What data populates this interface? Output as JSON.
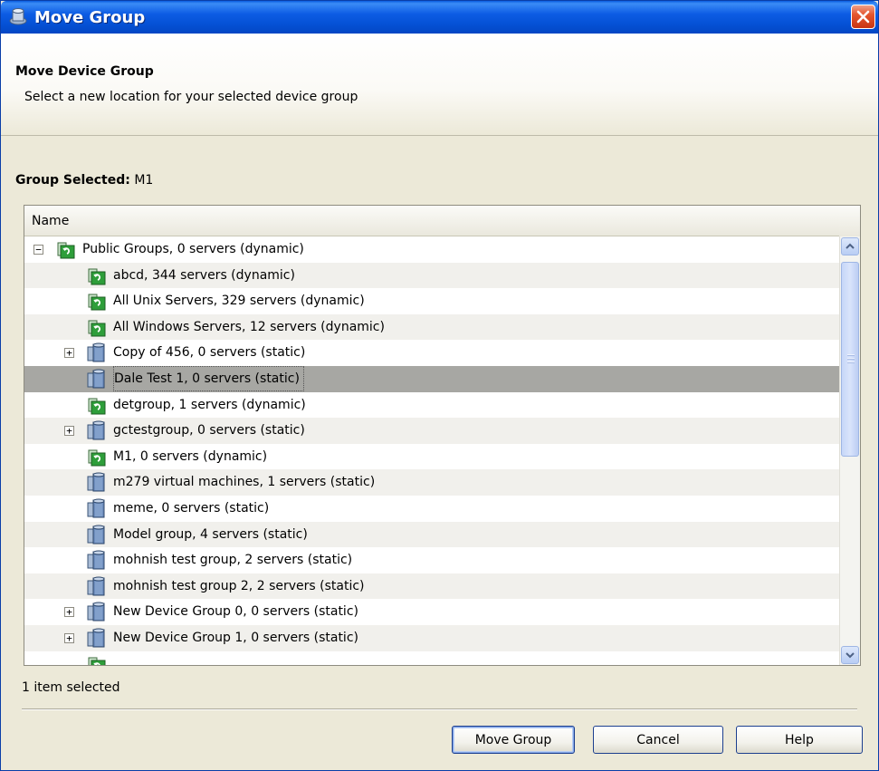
{
  "window": {
    "title": "Move Group"
  },
  "header": {
    "title": "Move Device Group",
    "subtitle": "Select a new location for your selected device group"
  },
  "group_selected": {
    "label": "Group Selected:",
    "value": "M1"
  },
  "table": {
    "column_header": "Name",
    "rows": [
      {
        "label": "Public Groups, 0 servers (dynamic)",
        "icon": "dynamic-group-icon",
        "expander": "minus",
        "level": 0
      },
      {
        "label": "abcd, 344 servers (dynamic)",
        "icon": "dynamic-group-icon",
        "expander": "",
        "level": 1
      },
      {
        "label": "All Unix Servers, 329 servers (dynamic)",
        "icon": "dynamic-group-icon",
        "expander": "",
        "level": 1
      },
      {
        "label": "All Windows Servers, 12 servers (dynamic)",
        "icon": "dynamic-group-icon",
        "expander": "",
        "level": 1
      },
      {
        "label": "Copy of 456, 0 servers (static)",
        "icon": "static-group-icon",
        "expander": "plus",
        "level": 1
      },
      {
        "label": "Dale Test 1, 0 servers (static)",
        "icon": "static-group-icon",
        "expander": "",
        "level": 1,
        "selected": true
      },
      {
        "label": "detgroup, 1 servers (dynamic)",
        "icon": "dynamic-group-icon",
        "expander": "",
        "level": 1
      },
      {
        "label": "gctestgroup, 0 servers (static)",
        "icon": "static-group-icon",
        "expander": "plus",
        "level": 1
      },
      {
        "label": "M1, 0 servers (dynamic)",
        "icon": "dynamic-group-icon",
        "expander": "",
        "level": 1
      },
      {
        "label": "m279 virtual machines, 1 servers (static)",
        "icon": "static-group-icon",
        "expander": "",
        "level": 1
      },
      {
        "label": "meme, 0 servers (static)",
        "icon": "static-group-icon",
        "expander": "",
        "level": 1
      },
      {
        "label": "Model group, 4 servers (static)",
        "icon": "static-group-icon",
        "expander": "",
        "level": 1
      },
      {
        "label": "mohnish test group, 2 servers (static)",
        "icon": "static-group-icon",
        "expander": "",
        "level": 1
      },
      {
        "label": "mohnish test group 2, 2 servers (static)",
        "icon": "static-group-icon",
        "expander": "",
        "level": 1
      },
      {
        "label": "New Device Group 0, 0 servers (static)",
        "icon": "static-group-icon",
        "expander": "plus",
        "level": 1
      },
      {
        "label": "New Device Group 1, 0 servers (static)",
        "icon": "static-group-icon",
        "expander": "plus",
        "level": 1
      },
      {
        "label": "",
        "icon": "dynamic-group-icon",
        "expander": "",
        "level": 1
      }
    ]
  },
  "status": {
    "text": "1 item selected"
  },
  "buttons": {
    "move_group": "Move Group",
    "cancel": "Cancel",
    "help": "Help"
  },
  "colors": {
    "titlebar": "#0552d6",
    "selected_row": "#a7a7a3",
    "alt_row": "#f1f0ec",
    "dialog_bg": "#ece9d8"
  }
}
